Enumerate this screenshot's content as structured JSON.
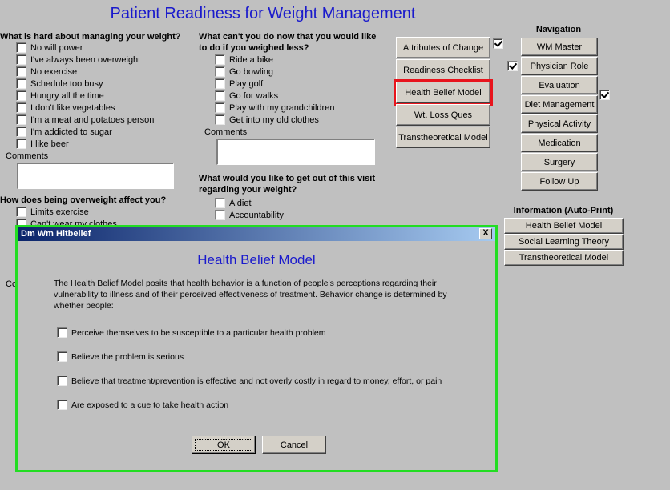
{
  "page_title": "Patient Readiness for Weight Management",
  "q1": {
    "heading": "What is hard about managing your weight?",
    "options": [
      "No will power",
      "I've always been overweight",
      "No exercise",
      "Schedule too busy",
      "Hungry all the time",
      "I don't like vegetables",
      "I'm a meat and potatoes person",
      "I'm addicted to sugar",
      "I like beer"
    ],
    "comments_label": "Comments"
  },
  "q2": {
    "heading_line1": "What can't you do now that you would like",
    "heading_line2": "to do if you weighed less?",
    "options": [
      "Ride a bike",
      "Go bowling",
      "Play golf",
      "Go for walks",
      "Play with my grandchildren",
      "Get into my old clothes"
    ],
    "comments_label": "Comments"
  },
  "q3": {
    "heading": "How does being overweight affect you?",
    "options": [
      "Limits exercise",
      "Can't wear my clothes"
    ],
    "comments_label_partial": "Co"
  },
  "q4": {
    "heading_line1": "What would you like to get out of this visit",
    "heading_line2": "regarding your weight?",
    "options": [
      "A diet",
      "Accountability"
    ]
  },
  "modules": {
    "buttons": [
      {
        "label": "Attributes of Change",
        "checked": true
      },
      {
        "label": "Readiness Checklist",
        "checked": true
      },
      {
        "label": "Health Belief Model",
        "checked": false,
        "highlighted": true
      },
      {
        "label": "Wt. Loss Ques",
        "checked": false
      },
      {
        "label": "Transtheoretical Model",
        "checked": false
      }
    ]
  },
  "navigation": {
    "title": "Navigation",
    "items": [
      {
        "label": "WM Master",
        "checked": false
      },
      {
        "label": "Physician Role",
        "checked": false
      },
      {
        "label": "Evaluation",
        "checked": true
      },
      {
        "label": "Diet Management",
        "checked": false
      },
      {
        "label": "Physical Activity",
        "checked": false
      },
      {
        "label": "Medication",
        "checked": false
      },
      {
        "label": "Surgery",
        "checked": false
      },
      {
        "label": "Follow Up",
        "checked": false
      }
    ]
  },
  "information": {
    "title": "Information (Auto-Print)",
    "items": [
      "Health Belief Model",
      "Social Learning Theory",
      "Transtheoretical Model"
    ]
  },
  "dialog": {
    "window_title": "Dm Wm Hltbelief",
    "close_glyph": "X",
    "heading": "Health Belief Model",
    "description": "The Health Belief Model posits that health behavior is a function of people's perceptions regarding their vulnerability to illness and of their perceived effectiveness of treatment. Behavior change is determined by whether people:",
    "options": [
      "Perceive themselves to be susceptible to a particular health problem",
      "Believe the problem is serious",
      "Believe that treatment/prevention is effective and not overly costly in regard to money, effort, or pain",
      "Are exposed to a cue to take health action"
    ],
    "ok_label": "OK",
    "cancel_label": "Cancel",
    "outline_color": "#22dd22"
  },
  "colors": {
    "title_blue": "#1a1acc",
    "highlight_red": "#e8141c"
  }
}
